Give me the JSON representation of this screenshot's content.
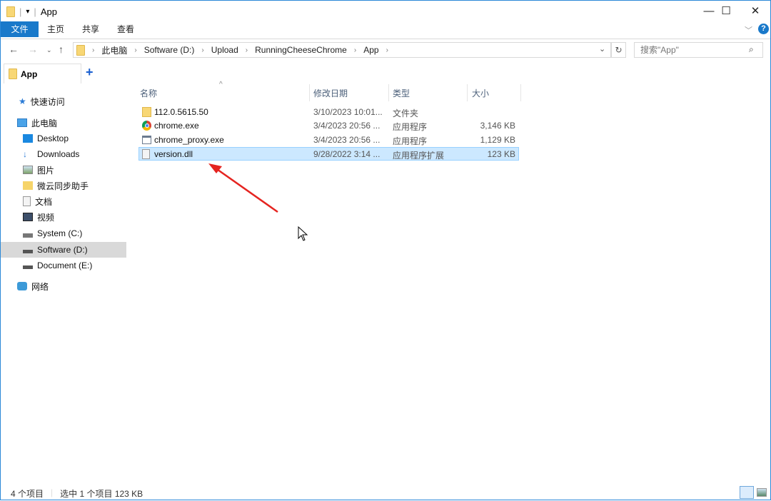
{
  "window": {
    "title": "App",
    "minimize": "—",
    "maximize": "☐",
    "close": "✕",
    "help": "?"
  },
  "ribbon": {
    "tabs": [
      "文件",
      "主页",
      "共享",
      "查看"
    ]
  },
  "address": {
    "crumbs": [
      "此电脑",
      "Software (D:)",
      "Upload",
      "RunningCheeseChrome",
      "App"
    ],
    "search_placeholder": "搜索\"App\""
  },
  "tab": {
    "label": "App",
    "add": "+"
  },
  "sidebar": {
    "items": [
      {
        "label": "快速访问",
        "icon": "star-icon"
      },
      {
        "label": "此电脑",
        "icon": "computer-icon"
      },
      {
        "label": "Desktop",
        "icon": "desktop-icon"
      },
      {
        "label": "Downloads",
        "icon": "download-icon"
      },
      {
        "label": "图片",
        "icon": "pictures-icon"
      },
      {
        "label": "微云同步助手",
        "icon": "cloud-icon"
      },
      {
        "label": "文档",
        "icon": "documents-icon"
      },
      {
        "label": "视频",
        "icon": "videos-icon"
      },
      {
        "label": "System (C:)",
        "icon": "drive-icon"
      },
      {
        "label": "Software (D:)",
        "icon": "drive-icon",
        "selected": true
      },
      {
        "label": "Document (E:)",
        "icon": "drive-icon"
      },
      {
        "label": "网络",
        "icon": "network-icon"
      }
    ]
  },
  "columns": [
    "名称",
    "修改日期",
    "类型",
    "大小"
  ],
  "files": [
    {
      "name": "112.0.5615.50",
      "date": "3/10/2023 10:01...",
      "type": "文件夹",
      "size": "",
      "icon": "folder-icon"
    },
    {
      "name": "chrome.exe",
      "date": "3/4/2023 20:56 ...",
      "type": "应用程序",
      "size": "3,146 KB",
      "icon": "chrome-icon"
    },
    {
      "name": "chrome_proxy.exe",
      "date": "3/4/2023 20:56 ...",
      "type": "应用程序",
      "size": "1,129 KB",
      "icon": "exe-icon"
    },
    {
      "name": "version.dll",
      "date": "9/28/2022 3:14 ...",
      "type": "应用程序扩展",
      "size": "123 KB",
      "icon": "dll-icon",
      "selected": true
    }
  ],
  "status": {
    "count": "4 个项目",
    "selected": "选中 1 个项目  123 KB"
  },
  "colors": {
    "accent": "#1979ca",
    "selection": "#cce8ff",
    "arrow": "#e52420"
  }
}
